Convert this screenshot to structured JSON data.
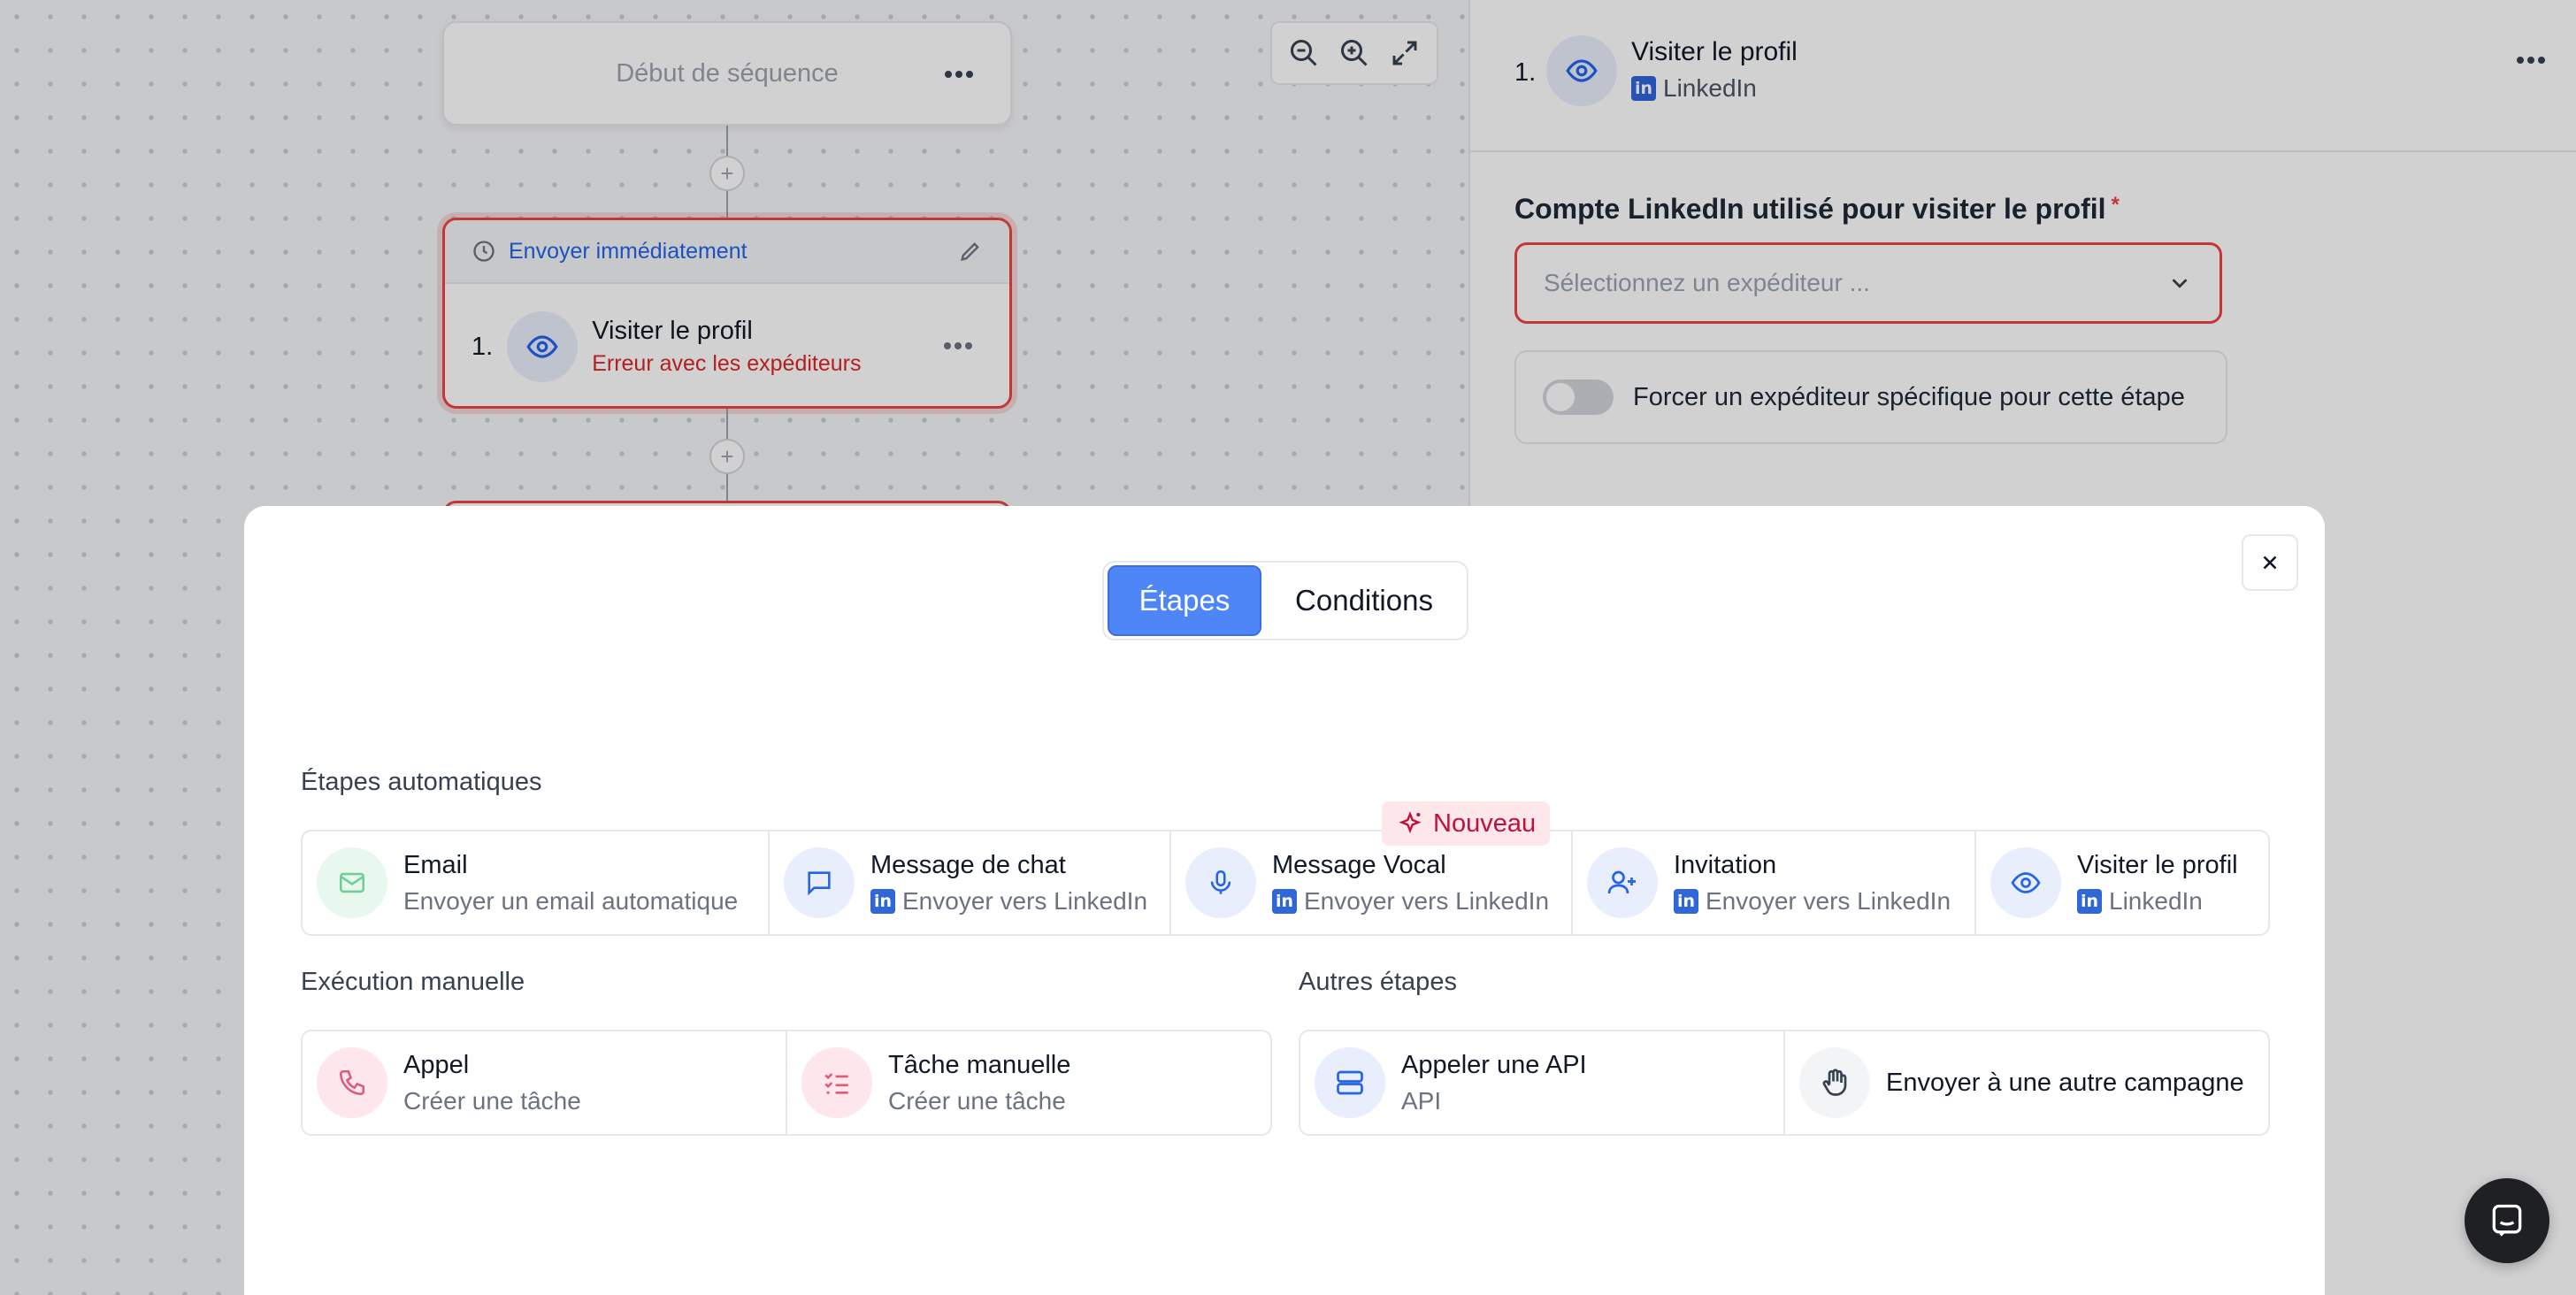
{
  "canvas": {
    "start_node": {
      "label": "Début de séquence"
    },
    "step_node": {
      "header": "Envoyer immédiatement",
      "number": "1.",
      "title": "Visiter le profil",
      "error": "Erreur avec les expéditeurs"
    }
  },
  "right_panel": {
    "number": "1.",
    "title": "Visiter le profil",
    "subtitle": "LinkedIn",
    "field_label": "Compte LinkedIn utilisé pour visiter le profil",
    "required_mark": "*",
    "select_placeholder": "Sélectionnez un expéditeur ...",
    "toggle_label": "Forcer un expéditeur spécifique pour cette étape",
    "toggle_on": false
  },
  "modal": {
    "tabs": [
      {
        "label": "Étapes",
        "active": true
      },
      {
        "label": "Conditions",
        "active": false
      }
    ],
    "automatic": {
      "title": "Étapes automatiques",
      "badge": "Nouveau",
      "cards": [
        {
          "title": "Email",
          "subtitle": "Envoyer un email automatique",
          "icon": "mail-icon",
          "linkedin": false
        },
        {
          "title": "Message de chat",
          "subtitle": "Envoyer vers LinkedIn",
          "icon": "chat-icon",
          "linkedin": true
        },
        {
          "title": "Message Vocal",
          "subtitle": "Envoyer vers LinkedIn",
          "icon": "microphone-icon",
          "linkedin": true
        },
        {
          "title": "Invitation",
          "subtitle": "Envoyer vers LinkedIn",
          "icon": "user-plus-icon",
          "linkedin": true
        },
        {
          "title": "Visiter le profil",
          "subtitle": "LinkedIn",
          "icon": "eye-icon",
          "linkedin": true
        }
      ]
    },
    "manual": {
      "title": "Exécution manuelle",
      "cards": [
        {
          "title": "Appel",
          "subtitle": "Créer une tâche",
          "icon": "phone-icon"
        },
        {
          "title": "Tâche manuelle",
          "subtitle": "Créer une tâche",
          "icon": "checklist-icon"
        }
      ]
    },
    "other": {
      "title": "Autres étapes",
      "cards": [
        {
          "title": "Appeler une API",
          "subtitle": "API",
          "icon": "server-icon"
        },
        {
          "title": "Envoyer à une autre campagne",
          "subtitle": "",
          "icon": "hand-icon"
        }
      ]
    }
  },
  "colors": {
    "accent": "#4f86f7",
    "error": "#ef4444",
    "linkedin": "#2f66d8"
  }
}
